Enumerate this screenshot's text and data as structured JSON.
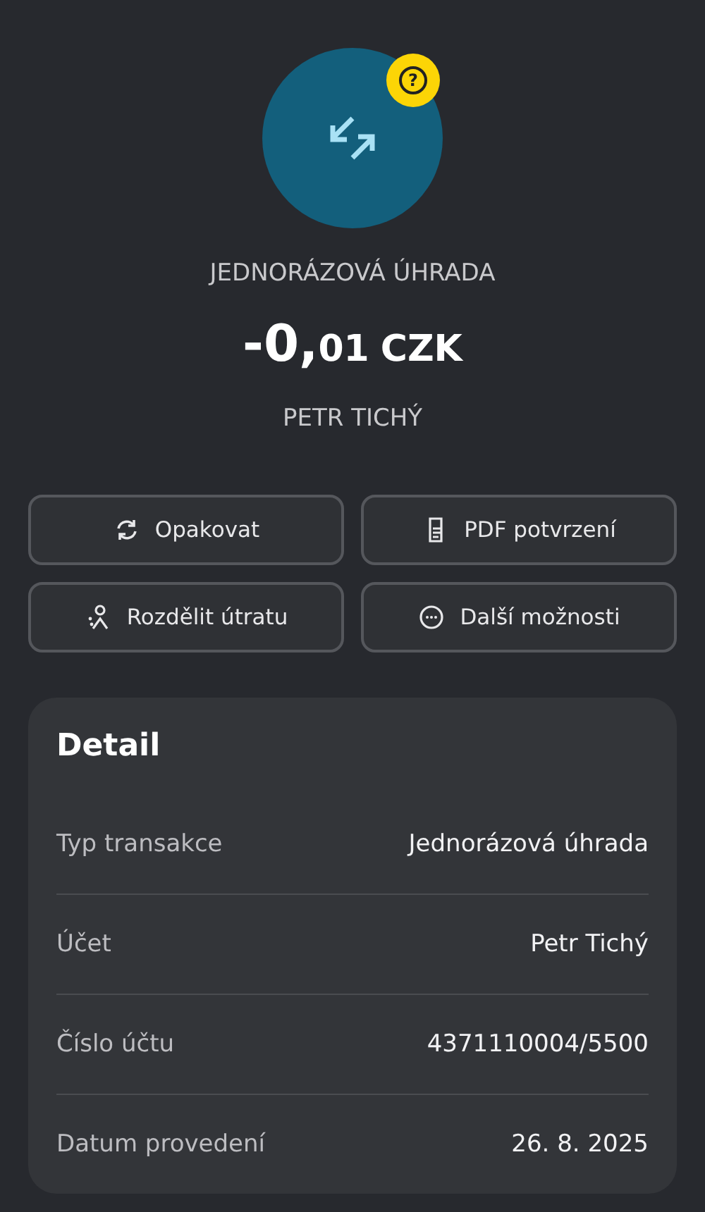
{
  "header": {
    "badge": "?",
    "type_label": "JEDNORÁZOVÁ ÚHRADA",
    "amount": {
      "whole": "-0,",
      "decimal": "01",
      "currency": "CZK"
    },
    "counterparty": "PETR TICHÝ"
  },
  "actions": [
    {
      "kind": "repeat",
      "label": "Opakovat"
    },
    {
      "kind": "pdf",
      "label": "PDF potvrzení"
    },
    {
      "kind": "split",
      "label": "Rozdělit útratu"
    },
    {
      "kind": "more",
      "label": "Další možnosti"
    }
  ],
  "detail": {
    "title": "Detail",
    "rows": [
      {
        "label": "Typ transakce",
        "value": "Jednorázová úhrada"
      },
      {
        "label": "Účet",
        "value": "Petr Tichý"
      },
      {
        "label": "Číslo účtu",
        "value": "4371110004/5500"
      },
      {
        "label": "Datum provedení",
        "value": "26. 8. 2025"
      }
    ]
  }
}
